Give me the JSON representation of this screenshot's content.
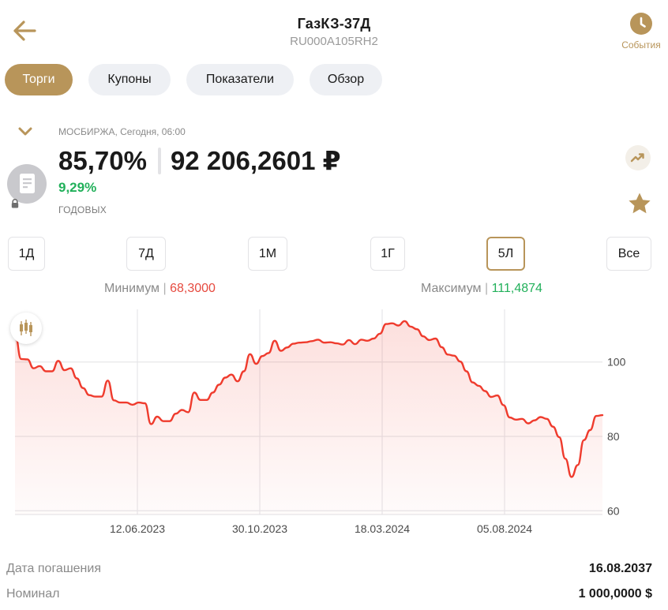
{
  "header": {
    "title": "ГазКЗ-37Д",
    "isin": "RU000A105RH2",
    "events_label": "События"
  },
  "colors": {
    "accent": "#b8955a",
    "positive": "#21b05a",
    "negative": "#e64a3f",
    "line": "#ef3b2d"
  },
  "tabs": [
    {
      "label": "Торги",
      "active": true
    },
    {
      "label": "Купоны",
      "active": false
    },
    {
      "label": "Показатели",
      "active": false
    },
    {
      "label": "Обзор",
      "active": false
    }
  ],
  "quote": {
    "exchange": "МОСБИРЖА, Сегодня, 06:00",
    "price_percent": "85,70%",
    "price_amount": "92 206,2601 ₽",
    "yield": "9,29%",
    "yield_label": "ГОДОВЫХ"
  },
  "periods": [
    {
      "label": "1Д",
      "active": false
    },
    {
      "label": "7Д",
      "active": false
    },
    {
      "label": "1М",
      "active": false
    },
    {
      "label": "1Г",
      "active": false
    },
    {
      "label": "5Л",
      "active": true
    },
    {
      "label": "Все",
      "active": false
    }
  ],
  "stats": {
    "min_label": "Минимум",
    "min_value": "68,3000",
    "max_label": "Максимум",
    "max_value": "111,4874"
  },
  "chart_data": {
    "type": "line",
    "x_ticks": [
      "12.06.2023",
      "30.10.2023",
      "18.03.2024",
      "05.08.2024"
    ],
    "y_ticks": [
      "100",
      "80",
      "60"
    ],
    "ylim": [
      59,
      115
    ],
    "series": [
      {
        "values": [
          107.5,
          100.8,
          100.7,
          98.3,
          98.9,
          97.5,
          97.5,
          100.3,
          97.8,
          98.3,
          95.6,
          93.0,
          91.1,
          90.7,
          90.7,
          95.0,
          89.7,
          89.1,
          89.1,
          88.5,
          89.1,
          88.9,
          83.3,
          85.3,
          84.1,
          84.1,
          86.1,
          87.1,
          86.5,
          91.8,
          89.8,
          89.8,
          91.8,
          93.9,
          95.8,
          96.6,
          94.8,
          97.5,
          102.1,
          99.5,
          101.6,
          102.4,
          105.7,
          103.0,
          103.9,
          104.9,
          105.2,
          105.3,
          105.6,
          106.0,
          105.2,
          105.3,
          105.0,
          104.7,
          105.9,
          104.8,
          106.0,
          105.7,
          106.3,
          107.6,
          110.2,
          110.4,
          109.8,
          111.0,
          109.5,
          108.8,
          106.9,
          105.9,
          106.3,
          104.0,
          102.0,
          101.7,
          100.1,
          97.5,
          94.5,
          93.6,
          92.2,
          90.6,
          91.0,
          88.4,
          85.1,
          84.5,
          84.7,
          83.5,
          84.3,
          85.2,
          84.7,
          82.6,
          79.8,
          74.0,
          69.1,
          72.3,
          79.0,
          81.7,
          85.5,
          85.7
        ]
      }
    ],
    "grid": true
  },
  "details": [
    {
      "label": "Дата погашения",
      "value": "16.08.2037"
    },
    {
      "label": "Номинал",
      "value": "1 000,0000 $"
    }
  ]
}
